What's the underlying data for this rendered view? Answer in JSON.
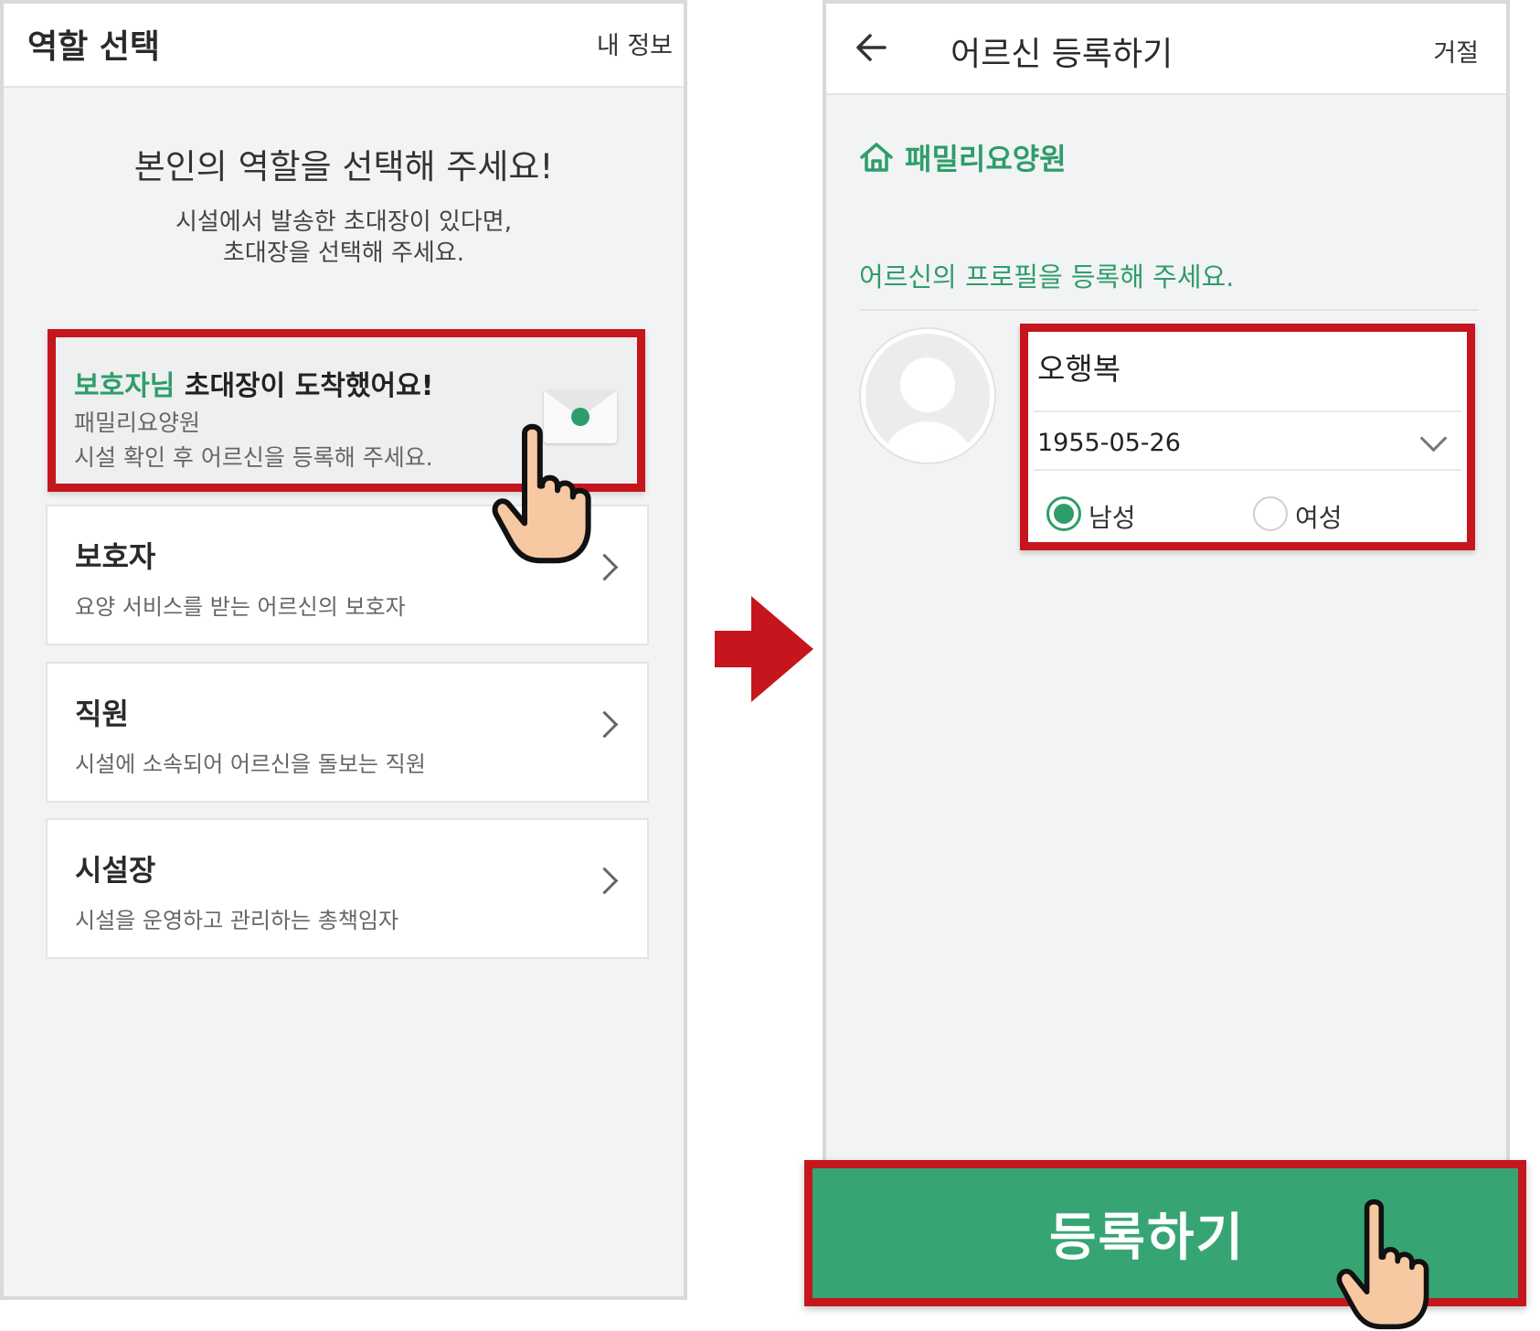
{
  "left_screen": {
    "title": "역할 선택",
    "my_info": "내 정보",
    "heading": "본인의 역할을 선택해 주세요!",
    "subtext_line1": "시설에서 발송한 초대장이 있다면,",
    "subtext_line2": "초대장을 선택해 주세요.",
    "invite": {
      "highlight": "보호자님",
      "title_rest": " 초대장이 도착했어요!",
      "facility": "패밀리요양원",
      "description": "시설 확인 후 어르신을 등록해 주세요.",
      "icon": "envelope-icon"
    },
    "roles": [
      {
        "title": "보호자",
        "description": "요양 서비스를 받는 어르신의 보호자"
      },
      {
        "title": "직원",
        "description": "시설에 소속되어 어르신을 돌보는 직원"
      },
      {
        "title": "시설장",
        "description": "시설을 운영하고 관리하는 총책임자"
      }
    ]
  },
  "right_screen": {
    "title": "어르신 등록하기",
    "reject": "거절",
    "facility": "패밀리요양원",
    "profile_prompt": "어르신의 프로필을 등록해 주세요.",
    "form": {
      "name": "오행복",
      "birth_date": "1955-05-26",
      "gender_options": [
        "남성",
        "여성"
      ],
      "selected_gender": "남성"
    },
    "register_button": "등록하기"
  },
  "colors": {
    "accent_green": "#2e9d6a",
    "button_green": "#36a573",
    "highlight_red": "#c4161c",
    "pointer_skin": "#f6c9a2"
  }
}
